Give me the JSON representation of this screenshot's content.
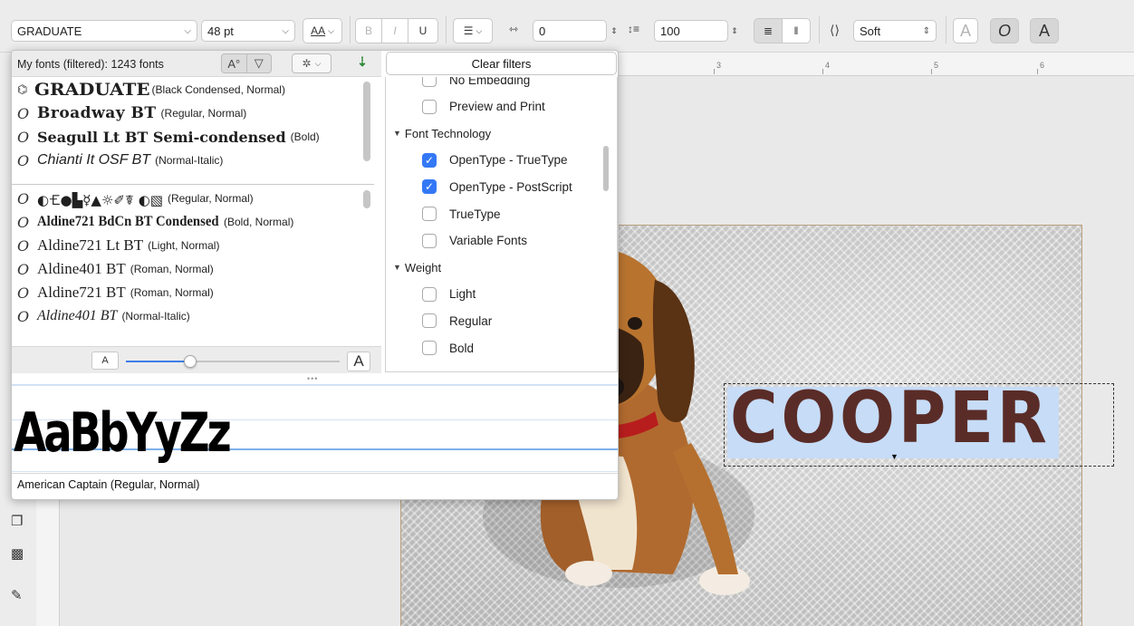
{
  "propbar": {
    "font_name": "GRADUATE",
    "font_size": "48 pt",
    "aa_label": "AA",
    "bold": "B",
    "italic": "I",
    "underline": "U",
    "kerning_value": "0",
    "line_spacing_value": "100",
    "antialias_mode": "Soft",
    "colors": {
      "accent": "#3478f6"
    }
  },
  "font_panel": {
    "count_label": "My fonts (filtered): 1243 fonts",
    "favorites": [
      {
        "name": "GRADUATE",
        "desc": "(Black Condensed, Normal)",
        "icon": "g-icon"
      },
      {
        "name": "Broadway BT",
        "desc": "(Regular, Normal)",
        "icon": "o-icon"
      },
      {
        "name": "Seagull Lt BT Semi-condensed",
        "desc": "(Bold)",
        "icon": "o-icon"
      },
      {
        "name": "Chianti It OSF BT",
        "desc": "(Normal-Italic)",
        "icon": "o-icon"
      }
    ],
    "fonts": [
      {
        "name": "◐🝗●▙☿▲☼✐☤ ◐▧",
        "desc": "(Regular, Normal)",
        "icon": "o-icon"
      },
      {
        "name": "Aldine721 BdCn BT Condensed",
        "desc": "(Bold, Normal)",
        "icon": "o-icon"
      },
      {
        "name": "Aldine721 Lt BT",
        "desc": "(Light, Normal)",
        "icon": "o-icon"
      },
      {
        "name": "Aldine401 BT",
        "desc": "(Roman, Normal)",
        "icon": "o-icon"
      },
      {
        "name": "Aldine721 BT",
        "desc": "(Roman, Normal)",
        "icon": "o-icon"
      },
      {
        "name": "Aldine401 BT",
        "desc": "(Normal-Italic)",
        "icon": "o-icon"
      }
    ],
    "size_small": "A",
    "size_large": "A",
    "size_level": 0.3,
    "preview_text": "AaBbYyZz",
    "preview_font_name": "American Captain (Regular, Normal)"
  },
  "filters": {
    "clear_label": "Clear filters",
    "rows": [
      {
        "type": "option",
        "label": "No Embedding",
        "checked": false
      },
      {
        "type": "option",
        "label": "Preview and Print",
        "checked": false
      },
      {
        "type": "group",
        "label": "Font Technology"
      },
      {
        "type": "option",
        "label": "OpenType - TrueType",
        "checked": true
      },
      {
        "type": "option",
        "label": "OpenType - PostScript",
        "checked": true
      },
      {
        "type": "option",
        "label": "TrueType",
        "checked": false
      },
      {
        "type": "option",
        "label": "Variable Fonts",
        "checked": false
      },
      {
        "type": "group",
        "label": "Weight"
      },
      {
        "type": "option",
        "label": "Light",
        "checked": false
      },
      {
        "type": "option",
        "label": "Regular",
        "checked": false
      },
      {
        "type": "option",
        "label": "Bold",
        "checked": false
      }
    ]
  },
  "ruler": {
    "labels": [
      "3",
      "4",
      "5",
      "6"
    ]
  },
  "canvas": {
    "headline": "COOPER",
    "headline_color": "#5a2c27",
    "highlight_color": "#c6dcf7"
  }
}
